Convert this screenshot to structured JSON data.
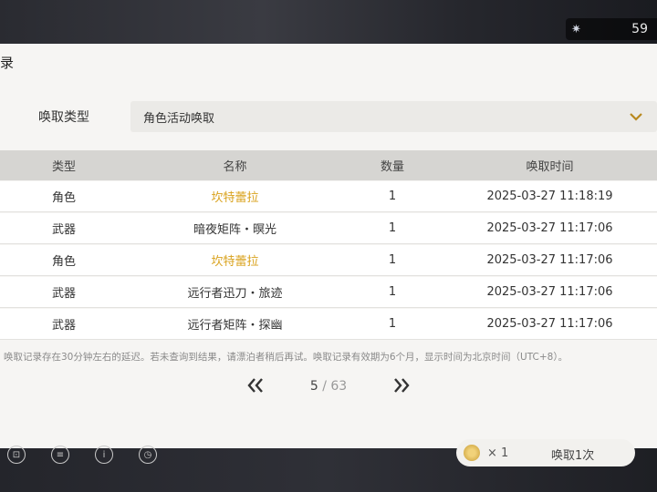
{
  "currency": {
    "icon": "star-icon",
    "amount": "59"
  },
  "panel": {
    "title": "录"
  },
  "filter": {
    "label": "唤取类型",
    "selected": "角色活动唤取"
  },
  "table": {
    "headers": [
      "类型",
      "名称",
      "数量",
      "唤取时间"
    ],
    "rows": [
      {
        "type": "角色",
        "name": "坎特蕾拉",
        "qty": "1",
        "time": "2025-03-27 11:18:19",
        "highlight": true
      },
      {
        "type": "武器",
        "name": "暗夜矩阵・暝光",
        "qty": "1",
        "time": "2025-03-27 11:17:06",
        "highlight": false
      },
      {
        "type": "角色",
        "name": "坎特蕾拉",
        "qty": "1",
        "time": "2025-03-27 11:17:06",
        "highlight": true
      },
      {
        "type": "武器",
        "name": "远行者迅刀・旅迹",
        "qty": "1",
        "time": "2025-03-27 11:17:06",
        "highlight": false
      },
      {
        "type": "武器",
        "name": "远行者矩阵・探幽",
        "qty": "1",
        "time": "2025-03-27 11:17:06",
        "highlight": false
      }
    ]
  },
  "note": "唤取记录存在30分钟左右的延迟。若未查询到结果，请漂泊者稍后再试。唤取记录有效期为6个月，显示时间为北京时间（UTC+8）。",
  "pager": {
    "current": "5",
    "separator": "/",
    "total": "63",
    "prev_icon": "double-chevron-left-icon",
    "next_icon": "double-chevron-right-icon"
  },
  "bottom": {
    "icons": [
      "cart-icon",
      "list-icon",
      "info-icon",
      "history-icon"
    ],
    "count": "× 1",
    "button": "唤取1次"
  },
  "colors": {
    "highlight": "#d9a21c",
    "panel_bg": "#f6f5f3",
    "header_bg": "#d6d5d2"
  }
}
